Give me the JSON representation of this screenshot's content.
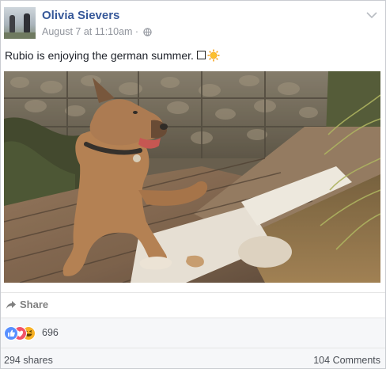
{
  "post": {
    "author": "Olivia Sievers",
    "timestamp": "August 7 at 11:10am",
    "separator": "·",
    "privacy_icon": "globe-icon",
    "text": "Rubio is enjoying the german summer.",
    "emoji": [
      "square-icon",
      "sun-icon"
    ]
  },
  "actions": {
    "share_label": "Share",
    "share_icon": "share-arrow-icon"
  },
  "reactions": {
    "types": [
      "like",
      "love",
      "haha"
    ],
    "count": "696"
  },
  "stats": {
    "shares": "294 shares",
    "comments": "104 Comments"
  },
  "colors": {
    "name_link": "#365899",
    "meta_text": "#90949c",
    "like": "#5890ff",
    "love": "#f25268",
    "haha": "#f7b125"
  }
}
